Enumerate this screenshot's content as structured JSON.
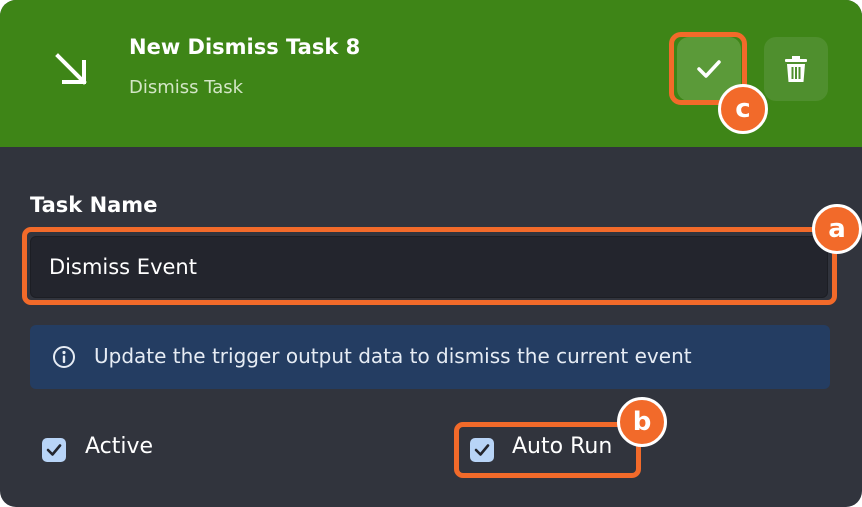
{
  "header": {
    "title": "New Dismiss Task 8",
    "subtitle": "Dismiss Task",
    "icon": "arrow-down-right-icon",
    "confirm_icon": "checkmark-icon",
    "delete_icon": "trash-icon",
    "background_color": "#3e8517"
  },
  "form": {
    "task_name_label": "Task Name",
    "task_name_value": "Dismiss Event",
    "info_icon": "info-circle-icon",
    "info_text": "Update the trigger output data to dismiss the current event",
    "active_label": "Active",
    "active_checked": true,
    "auto_run_label": "Auto Run",
    "auto_run_checked": true
  },
  "annotations": {
    "highlight_color": "#f26a2a",
    "badges": [
      "a",
      "b",
      "c"
    ]
  }
}
